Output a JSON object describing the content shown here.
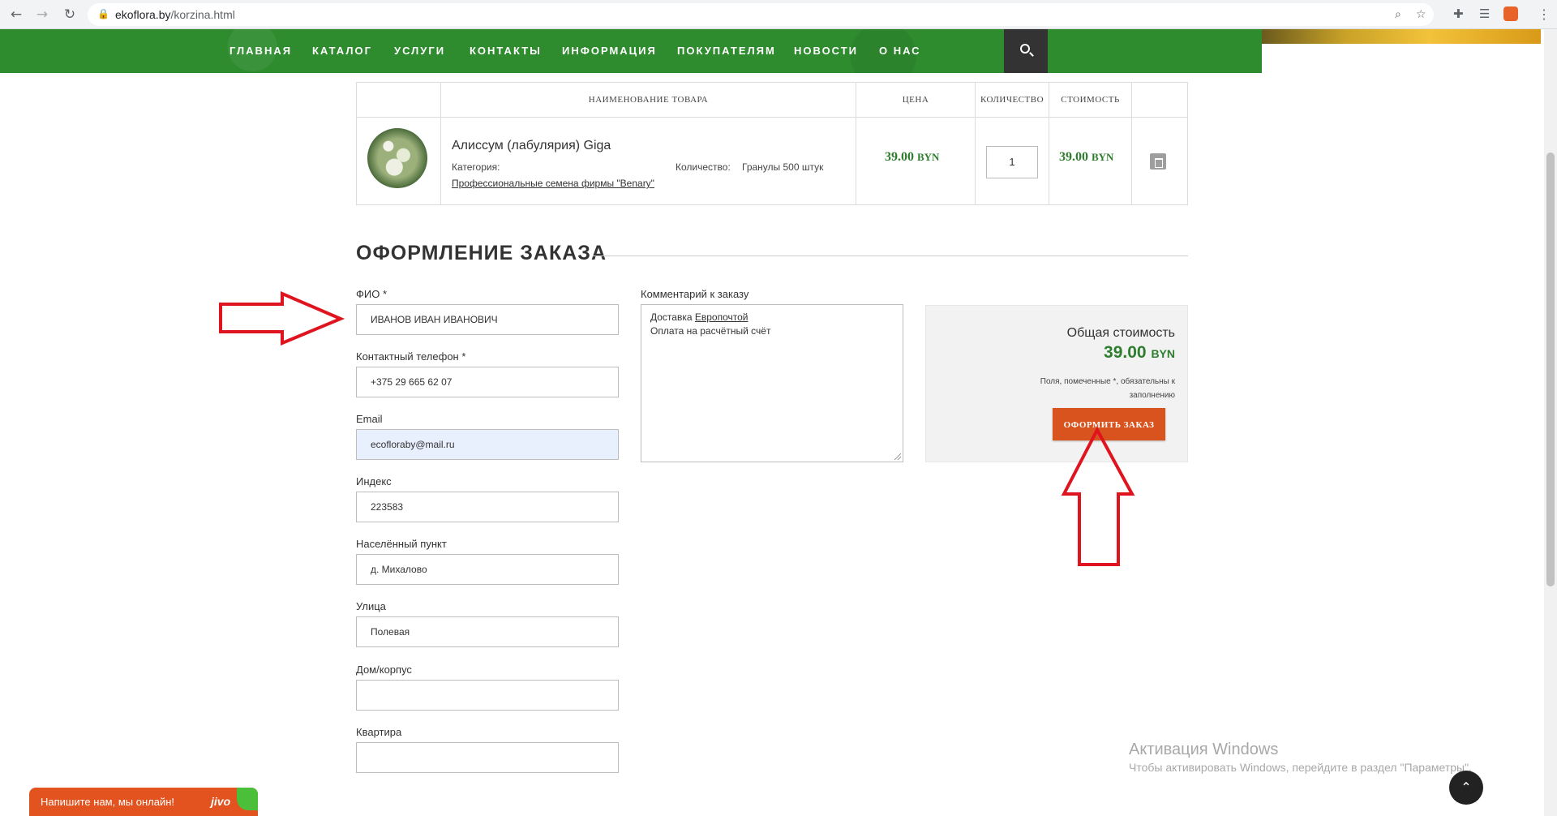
{
  "browser": {
    "url_host": "ekoflora.by",
    "url_path": "/korzina.html"
  },
  "nav": {
    "items": [
      "ГЛАВНАЯ",
      "КАТАЛОГ",
      "УСЛУГИ",
      "КОНТАКТЫ",
      "ИНФОРМАЦИЯ",
      "ПОКУПАТЕЛЯМ",
      "НОВОСТИ",
      "О НАС"
    ]
  },
  "cart": {
    "headers": {
      "name": "НАИМЕНОВАНИЕ ТОВАРА",
      "price": "ЦЕНА",
      "quantity": "КОЛИЧЕСТВО",
      "cost": "СТОИМОСТЬ"
    },
    "item": {
      "name": "Алиссум (лабулярия) Giga",
      "category_label": "Категория:",
      "category_link": "Профессиональные семена фирмы \"Benary\"",
      "qty_label": "Количество:",
      "qty_value": "Гранулы 500 штук",
      "price": "39.00",
      "currency": "BYN",
      "quantity": "1",
      "cost": "39.00"
    }
  },
  "checkout": {
    "title": "ОФОРМЛЕНИЕ ЗАКАЗА",
    "fields": {
      "fio_label": "ФИО *",
      "fio_value": "ИВАНОВ ИВАН ИВАНОВИЧ",
      "phone_label": "Контактный телефон *",
      "phone_value": "+375 29 665 62 07",
      "email_label": "Email",
      "email_value": "ecofloraby@mail.ru",
      "index_label": "Индекс",
      "index_value": "223583",
      "city_label": "Населённый пункт",
      "city_value": "д. Михалово",
      "street_label": "Улица",
      "street_value": "Полевая",
      "house_label": "Дом/корпус",
      "house_value": "",
      "flat_label": "Квартира",
      "flat_value": ""
    },
    "comment": {
      "label": "Комментарий к заказу",
      "line1_prefix": "Доставка ",
      "line1_link": "Европочтой",
      "line2": "Оплата на расчётный счёт"
    },
    "summary": {
      "total_label": "Общая стоимость",
      "total_value": "39.00",
      "currency": "BYN",
      "required_note": "Поля, помеченные *, обязательны к заполнению",
      "order_button": "ОФОРМИТЬ ЗАКАЗ"
    }
  },
  "watermark": {
    "title": "Активация Windows",
    "subtitle": "Чтобы активировать Windows, перейдите в раздел \"Параметры\"."
  },
  "chat": {
    "text": "Напишите нам, мы онлайн!",
    "logo": "jivo"
  },
  "colors": {
    "nav_green": "#2e8b2e",
    "price_green": "#2e7d2e",
    "order_orange": "#d9531e",
    "arrow_red": "#e0141e"
  },
  "icons": [
    "back-arrow-icon",
    "forward-arrow-icon",
    "reload-icon",
    "lock-icon",
    "zoom-icon",
    "star-icon",
    "extensions-icon",
    "reading-list-icon",
    "search-icon",
    "trash-icon",
    "scroll-top-icon"
  ]
}
